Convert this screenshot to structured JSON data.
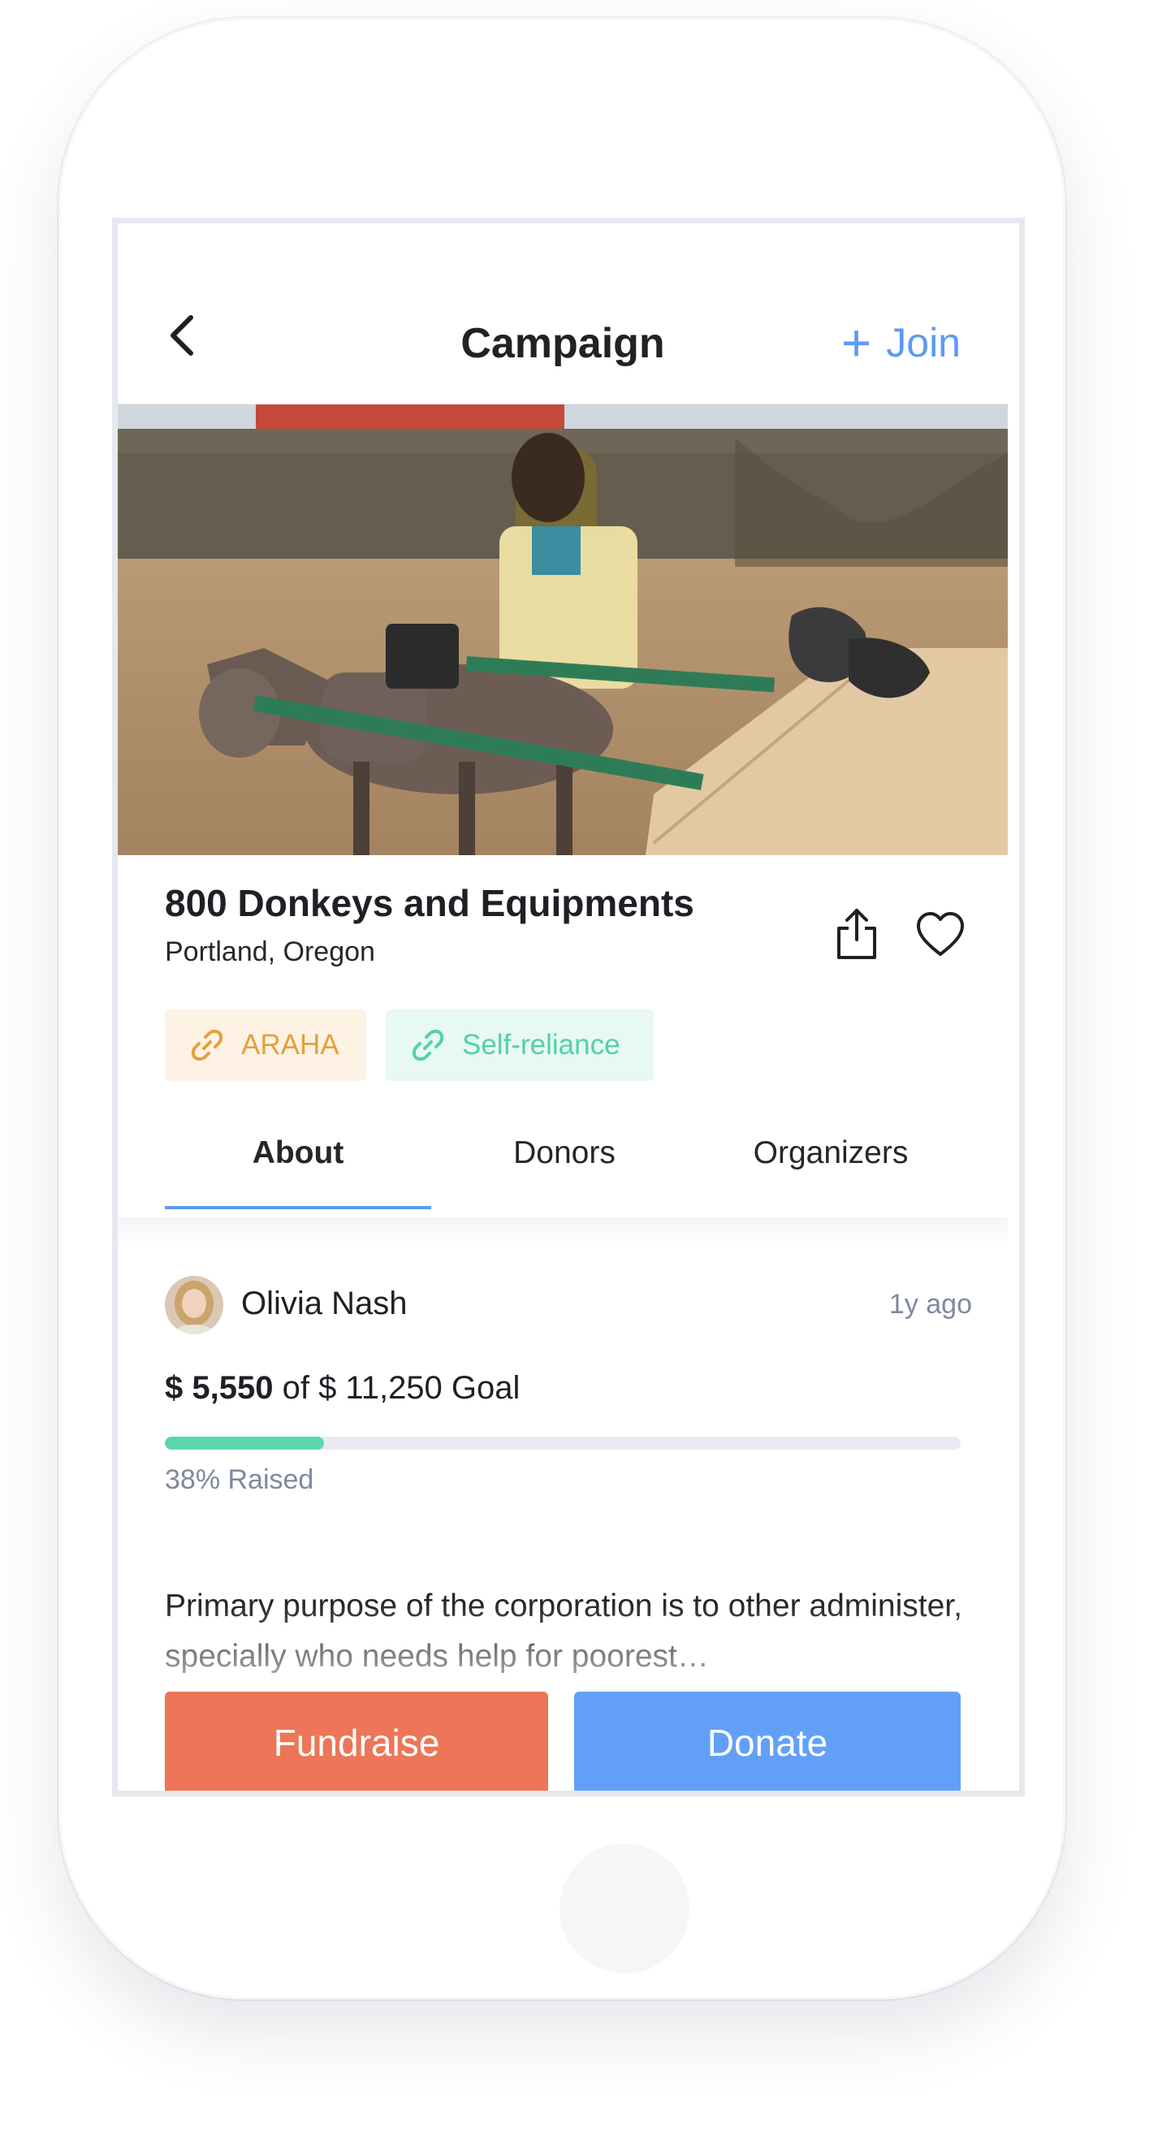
{
  "header": {
    "title": "Campaign",
    "join_label": "Join"
  },
  "campaign": {
    "title": "800 Donkeys and Equipments",
    "location": "Portland, Oregon",
    "tags": [
      {
        "label": "ARAHA",
        "color": "#e3a13a"
      },
      {
        "label": "Self-reliance",
        "color": "#52d1a7"
      }
    ]
  },
  "tabs": [
    {
      "label": "About",
      "active": true
    },
    {
      "label": "Donors",
      "active": false
    },
    {
      "label": "Organizers",
      "active": false
    }
  ],
  "organizer": {
    "name": "Olivia Nash",
    "time": "1y ago"
  },
  "funding": {
    "raised": "$ 5,550",
    "goal_text": "of $ 11,250 Goal",
    "percent_raised": 0.2,
    "percent_label": "38% Raised",
    "bar_color": "#5dd6ae"
  },
  "description": "Primary purpose of the corporation is to other administer, specially who needs help for poorest…",
  "actions": {
    "fundraise_label": "Fundraise",
    "donate_label": "Donate"
  },
  "colors": {
    "accent": "#5c9bf2",
    "fundraise": "#ec7657",
    "donate": "#62a0f8"
  },
  "icons": [
    "back-chevron-icon",
    "plus-icon",
    "share-icon",
    "heart-icon",
    "link-icon"
  ]
}
